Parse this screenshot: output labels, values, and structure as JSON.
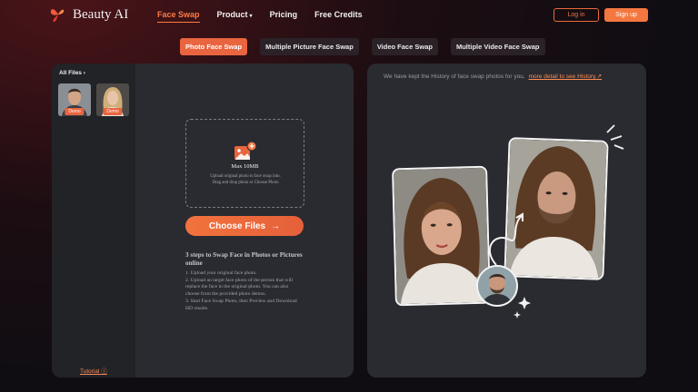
{
  "header": {
    "brand": "Beauty AI",
    "nav": [
      {
        "label": "Face Swap"
      },
      {
        "label": "Product"
      },
      {
        "label": "Pricing"
      },
      {
        "label": "Free Credits"
      }
    ],
    "login_label": "Log in",
    "signup_label": "Sign up"
  },
  "tabs": [
    {
      "label": "Photo Face Swap"
    },
    {
      "label": "Multiple Picture Face Swap"
    },
    {
      "label": "Video Face Swap"
    },
    {
      "label": "Multiple Video Face Swap"
    }
  ],
  "sidebar": {
    "all_files": "All Files",
    "demo_label": "Demo",
    "tutorial": "Tutorial"
  },
  "upload": {
    "max_size": "Max 10MB",
    "desc_line1": "Upload original photo to face swap into.",
    "desc_line2": "Drag and drop photo or Choose Photo",
    "choose_button": "Choose Files"
  },
  "steps": {
    "title": "3 steps to Swap Face in Photos or Pictures online",
    "items": [
      "1. Upload your original face photo.",
      "2. Upload an target face photo of the person that will replace the face in the original photo. You can also choose from the provided photo demos.",
      "3. Start Face Swap Photo, then Preview and Download HD results."
    ]
  },
  "history": {
    "text": "We have kept the History of face swap photos for you,",
    "link": "more detail to see History."
  },
  "colors": {
    "accent": "#F4773F",
    "panel": "#2A2B30",
    "sidebar": "#222327"
  }
}
